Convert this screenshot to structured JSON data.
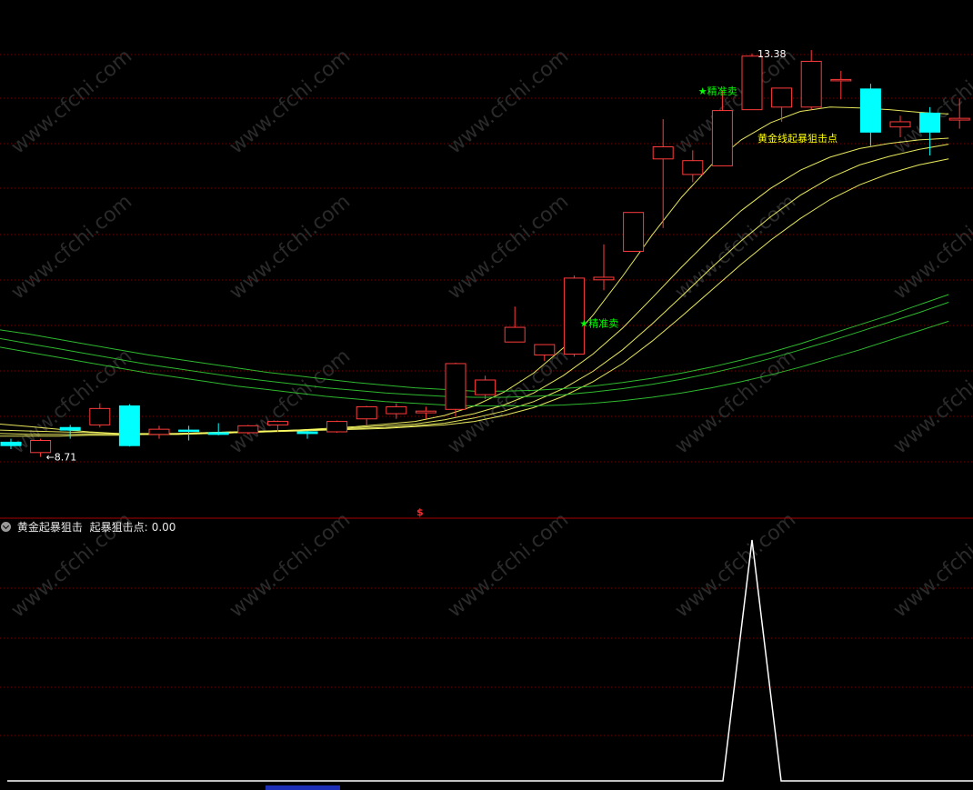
{
  "indicator_panel": {
    "name": "黄金起暴狙击",
    "value_label": "起暴狙击点:",
    "value": "0.00"
  },
  "divider_marker": "$",
  "watermark": "www.cfchi.com",
  "colors": {
    "background": "#000000",
    "up_candle": "#ff3b3b",
    "down_candle": "#00ffff",
    "grid": "#7a0000",
    "ma_yellow": "#ffff66",
    "ma_green": "#33cc33",
    "signal_label": "#00ff00",
    "annotation_yellow": "#ffff00",
    "indicator_line": "#ffffff"
  },
  "chart_data": [
    {
      "type": "candlestick",
      "title": "",
      "price_range": [
        8.0,
        14.0
      ],
      "candles": [
        {
          "o": 8.88,
          "h": 8.92,
          "l": 8.8,
          "c": 8.84
        },
        {
          "o": 8.76,
          "h": 8.92,
          "l": 8.71,
          "c": 8.9
        },
        {
          "o": 9.05,
          "h": 9.08,
          "l": 8.92,
          "c": 9.02
        },
        {
          "o": 9.08,
          "h": 9.33,
          "l": 9.05,
          "c": 9.27
        },
        {
          "o": 9.3,
          "h": 9.32,
          "l": 8.83,
          "c": 8.84
        },
        {
          "o": 8.97,
          "h": 9.07,
          "l": 8.92,
          "c": 9.03
        },
        {
          "o": 9.02,
          "h": 9.07,
          "l": 8.9,
          "c": 9.01
        },
        {
          "o": 8.99,
          "h": 9.1,
          "l": 8.96,
          "c": 8.97
        },
        {
          "o": 8.99,
          "h": 9.08,
          "l": 8.97,
          "c": 9.07
        },
        {
          "o": 9.08,
          "h": 9.13,
          "l": 9.0,
          "c": 9.12
        },
        {
          "o": 9.0,
          "h": 9.01,
          "l": 8.92,
          "c": 8.98
        },
        {
          "o": 9.0,
          "h": 9.13,
          "l": 8.99,
          "c": 9.12
        },
        {
          "o": 9.15,
          "h": 9.3,
          "l": 9.08,
          "c": 9.29
        },
        {
          "o": 9.21,
          "h": 9.33,
          "l": 9.15,
          "c": 9.29
        },
        {
          "o": 9.22,
          "h": 9.29,
          "l": 9.15,
          "c": 9.24
        },
        {
          "o": 9.26,
          "h": 9.8,
          "l": 9.18,
          "c": 9.79
        },
        {
          "o": 9.43,
          "h": 9.65,
          "l": 9.38,
          "c": 9.6
        },
        {
          "o": 10.04,
          "h": 10.45,
          "l": 10.04,
          "c": 10.21
        },
        {
          "o": 9.89,
          "h": 10.01,
          "l": 9.82,
          "c": 10.01
        },
        {
          "o": 9.9,
          "h": 10.81,
          "l": 9.87,
          "c": 10.78
        },
        {
          "o": 10.76,
          "h": 11.17,
          "l": 10.64,
          "c": 10.79
        },
        {
          "o": 11.09,
          "h": 11.54,
          "l": 11.09,
          "c": 11.54
        },
        {
          "o": 12.16,
          "h": 12.62,
          "l": 11.36,
          "c": 12.3
        },
        {
          "o": 11.98,
          "h": 12.26,
          "l": 11.89,
          "c": 12.14
        },
        {
          "o": 12.08,
          "h": 12.95,
          "l": 12.08,
          "c": 12.72
        },
        {
          "o": 12.73,
          "h": 13.38,
          "l": 12.73,
          "c": 13.35
        },
        {
          "o": 12.76,
          "h": 12.93,
          "l": 12.59,
          "c": 12.98
        },
        {
          "o": 12.76,
          "h": 13.42,
          "l": 12.73,
          "c": 13.29
        },
        {
          "o": 13.08,
          "h": 13.18,
          "l": 12.85,
          "c": 13.08
        },
        {
          "o": 12.97,
          "h": 13.03,
          "l": 12.31,
          "c": 12.47
        },
        {
          "o": 12.53,
          "h": 12.66,
          "l": 12.41,
          "c": 12.59
        },
        {
          "o": 12.69,
          "h": 12.76,
          "l": 12.2,
          "c": 12.47
        },
        {
          "o": 12.61,
          "h": 12.86,
          "l": 12.51,
          "c": 12.63
        }
      ],
      "moving_averages": [
        {
          "color": "#ffff66",
          "values": [
            9.09,
            9.06,
            9.03,
            9.0,
            8.98,
            8.97,
            8.97,
            8.98,
            8.99,
            9.0,
            9.02,
            9.04,
            9.06,
            9.09,
            9.12,
            9.19,
            9.3,
            9.46,
            9.68,
            9.97,
            10.35,
            10.8,
            11.28,
            11.72,
            12.09,
            12.38,
            12.58,
            12.71,
            12.76,
            12.75,
            12.73,
            12.7,
            12.68
          ]
        },
        {
          "color": "#ffff66",
          "values": [
            9.02,
            9.01,
            9.0,
            8.99,
            8.98,
            8.98,
            8.98,
            8.99,
            9.0,
            9.01,
            9.02,
            9.03,
            9.05,
            9.07,
            9.09,
            9.14,
            9.21,
            9.31,
            9.45,
            9.65,
            9.9,
            10.2,
            10.55,
            10.91,
            11.25,
            11.56,
            11.82,
            12.03,
            12.18,
            12.28,
            12.34,
            12.38,
            12.4
          ]
        },
        {
          "color": "#ffff66",
          "values": [
            8.98,
            8.97,
            8.97,
            8.97,
            8.97,
            8.97,
            8.98,
            8.99,
            9.0,
            9.01,
            9.02,
            9.03,
            9.04,
            9.05,
            9.07,
            9.1,
            9.16,
            9.24,
            9.35,
            9.5,
            9.7,
            9.95,
            10.25,
            10.57,
            10.9,
            11.21,
            11.49,
            11.74,
            11.94,
            12.09,
            12.19,
            12.27,
            12.33
          ]
        },
        {
          "color": "#ffff66",
          "values": [
            8.95,
            8.95,
            8.95,
            8.96,
            8.96,
            8.97,
            8.97,
            8.98,
            8.99,
            9.0,
            9.01,
            9.02,
            9.03,
            9.04,
            9.06,
            9.08,
            9.12,
            9.19,
            9.28,
            9.41,
            9.58,
            9.79,
            10.05,
            10.34,
            10.64,
            10.94,
            11.22,
            11.47,
            11.69,
            11.86,
            11.99,
            12.09,
            12.16
          ]
        },
        {
          "color": "#33cc33",
          "values": [
            10.18,
            10.13,
            10.07,
            10.01,
            9.95,
            9.89,
            9.84,
            9.79,
            9.74,
            9.69,
            9.65,
            9.61,
            9.57,
            9.54,
            9.51,
            9.49,
            9.47,
            9.47,
            9.48,
            9.5,
            9.53,
            9.57,
            9.62,
            9.68,
            9.75,
            9.83,
            9.92,
            10.02,
            10.13,
            10.24,
            10.35,
            10.47,
            10.59
          ]
        },
        {
          "color": "#33cc33",
          "values": [
            10.08,
            10.02,
            9.96,
            9.9,
            9.84,
            9.78,
            9.73,
            9.68,
            9.63,
            9.59,
            9.55,
            9.51,
            9.48,
            9.45,
            9.43,
            9.41,
            9.4,
            9.4,
            9.41,
            9.43,
            9.46,
            9.5,
            9.55,
            9.61,
            9.68,
            9.76,
            9.85,
            9.95,
            10.05,
            10.16,
            10.27,
            10.38,
            10.5
          ]
        },
        {
          "color": "#33cc33",
          "values": [
            9.98,
            9.92,
            9.86,
            9.8,
            9.74,
            9.68,
            9.63,
            9.58,
            9.53,
            9.49,
            9.45,
            9.41,
            9.38,
            9.35,
            9.33,
            9.31,
            9.3,
            9.3,
            9.3,
            9.31,
            9.33,
            9.36,
            9.4,
            9.45,
            9.51,
            9.58,
            9.66,
            9.75,
            9.85,
            9.95,
            10.06,
            10.17,
            10.28
          ]
        }
      ],
      "annotations": [
        {
          "text": "←8.71",
          "candle": 1,
          "price": 8.71,
          "color": "#ffffff"
        },
        {
          "text": "13.38",
          "candle": 25,
          "price": 13.38,
          "color": "#ffffff"
        },
        {
          "text": "★精准卖",
          "candle": 19,
          "price": 10.26,
          "color": "#00ff00"
        },
        {
          "text": "★精准卖",
          "candle": 23,
          "price": 12.95,
          "color": "#00ff00"
        },
        {
          "text": "黄金线起暴狙击点",
          "candle": 25,
          "price": 12.4,
          "color": "#ffff00"
        }
      ]
    },
    {
      "type": "line",
      "title": "",
      "series": [
        {
          "values": [
            0,
            0,
            0,
            0,
            0,
            0,
            0,
            0,
            0,
            0,
            0,
            0,
            0,
            0,
            0,
            0,
            0,
            0,
            0,
            0,
            0,
            0,
            0,
            0,
            0,
            1,
            0,
            0,
            0,
            0,
            0,
            0,
            0
          ]
        }
      ],
      "ylim": [
        0,
        1
      ]
    }
  ]
}
